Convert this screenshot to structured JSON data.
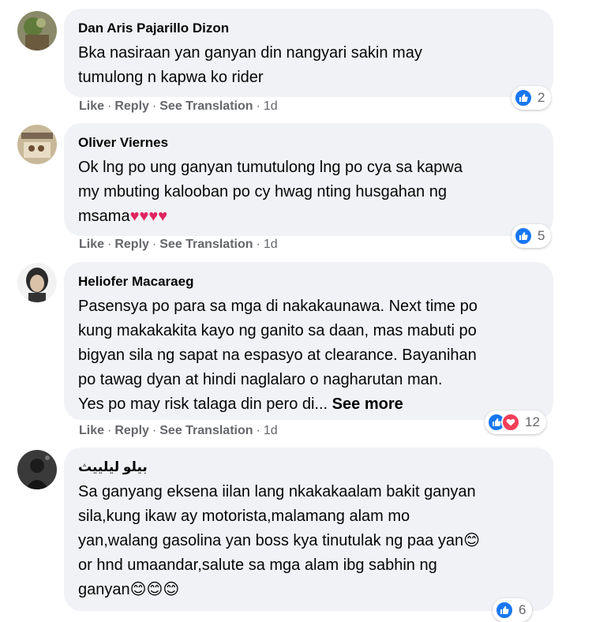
{
  "comments": [
    {
      "author": "Dan Aris Pajarillo Dizon",
      "text": "Bka nasiraan yan ganyan din nangyari sakin may\ntumulong n kapwa ko rider",
      "actions": {
        "like": "Like",
        "reply": "Reply",
        "translate": "See Translation",
        "time": "1d"
      },
      "reaction_count": "2"
    },
    {
      "author": "Oliver Viernes",
      "text": "Ok lng po ung ganyan tumutulong lng po cya sa kapwa\nmy mbuting kalooban po cy hwag nting husgahan ng\nmsama",
      "hearts": "♥♥♥♥",
      "actions": {
        "like": "Like",
        "reply": "Reply",
        "translate": "See Translation",
        "time": "1d"
      },
      "reaction_count": "5"
    },
    {
      "author": "Heliofer Macaraeg",
      "text": "Pasensya po para sa mga di nakakaunawa. Next time po\nkung makakakita kayo ng ganito sa daan, mas mabuti po\nbigyan sila ng sapat na espasyo at clearance. Bayanihan\npo tawag dyan at hindi naglalaro o nagharutan man.\nYes po may risk talaga din pero di...",
      "see_more": "See more",
      "actions": {
        "like": "Like",
        "reply": "Reply",
        "translate": "See Translation",
        "time": "1d"
      },
      "reaction_count": "12"
    },
    {
      "author": "بيلو ليلييث",
      "text": "Sa ganyang eksena iilan lang nkakakaalam bakit ganyan\nsila,kung ikaw ay motorista,malamang alam mo\nyan,walang gasolina yan boss kya tinutulak ng paa yan",
      "text2": "or hnd umaandar,salute sa mga alam ibg sabhin ng\nganyan",
      "emoji_inline": "😊",
      "emoji_end": "😊😊😊",
      "reaction_count": "6"
    }
  ],
  "colors": {
    "bubble": "#f0f2f5",
    "like_blue": "#1877f2",
    "love_red": "#f33e58",
    "meta_gray": "#65676b"
  },
  "icons": {
    "like": "thumbs-up-icon",
    "love": "heart-icon"
  }
}
